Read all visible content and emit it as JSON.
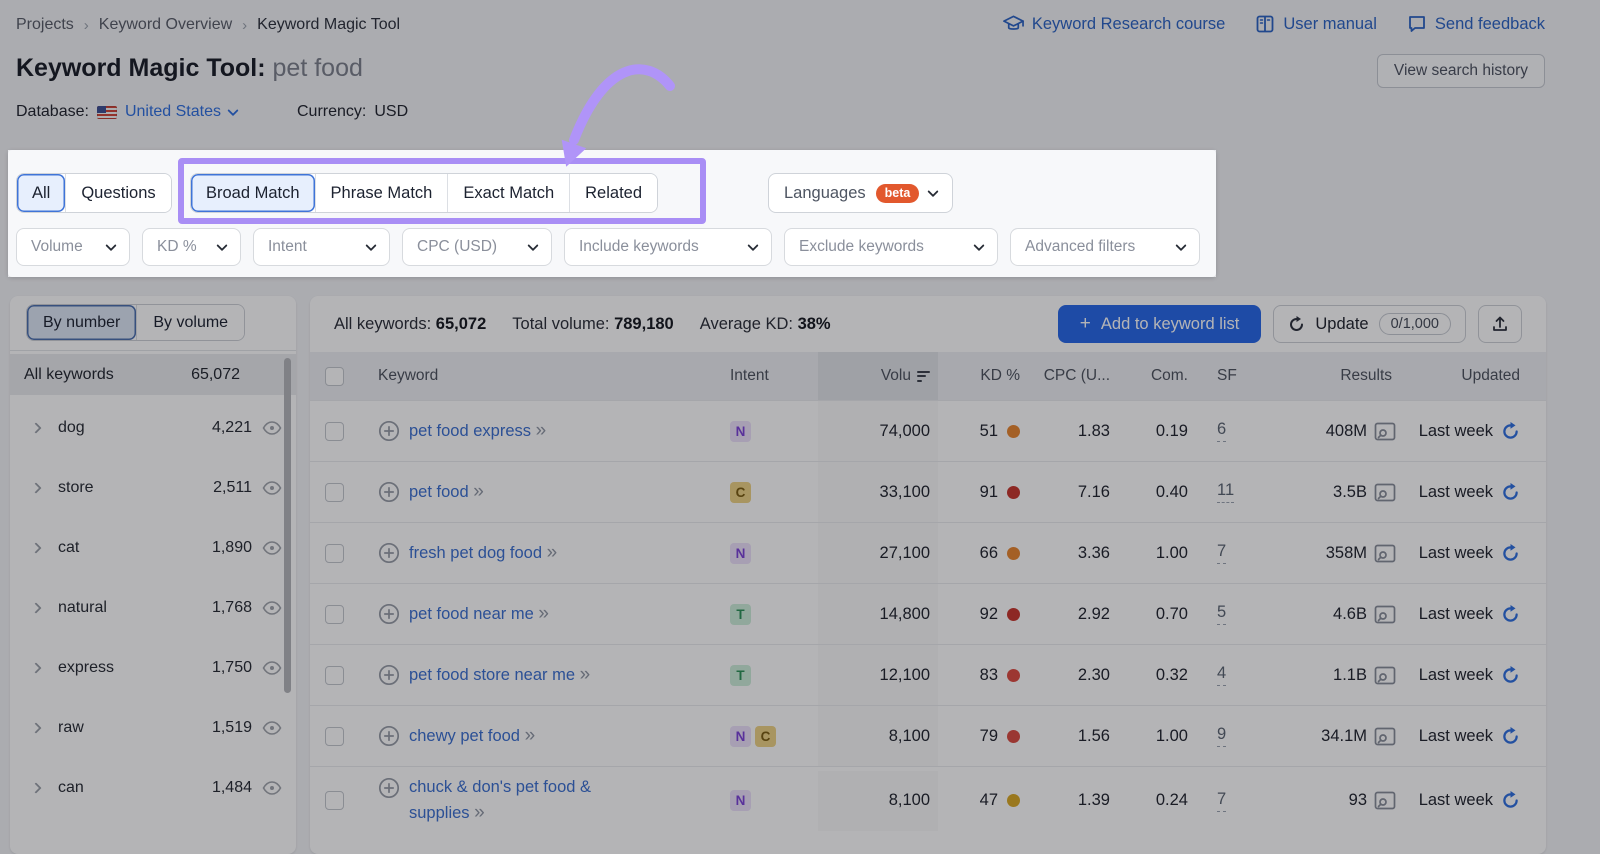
{
  "breadcrumb": {
    "items": [
      "Projects",
      "Keyword Overview",
      "Keyword Magic Tool"
    ]
  },
  "header": {
    "title": "Keyword Magic Tool:",
    "query": "pet food",
    "links": [
      {
        "label": "Keyword Research course",
        "icon": "graduation-cap-icon"
      },
      {
        "label": "User manual",
        "icon": "book-icon"
      },
      {
        "label": "Send feedback",
        "icon": "chat-icon"
      }
    ],
    "view_history": "View search history",
    "database_label": "Database:",
    "database_value": "United States",
    "currency_label": "Currency:",
    "currency_value": "USD"
  },
  "filters": {
    "scope_tabs": [
      {
        "label": "All",
        "selected": true
      },
      {
        "label": "Questions",
        "selected": false
      }
    ],
    "match_tabs": [
      {
        "label": "Broad Match",
        "selected": true
      },
      {
        "label": "Phrase Match",
        "selected": false
      },
      {
        "label": "Exact Match",
        "selected": false
      },
      {
        "label": "Related",
        "selected": false
      }
    ],
    "languages_label": "Languages",
    "beta_label": "beta",
    "dropdowns": [
      "Volume",
      "KD %",
      "Intent",
      "CPC (USD)",
      "Include keywords",
      "Exclude keywords",
      "Advanced filters"
    ]
  },
  "sidebar": {
    "toggle": [
      {
        "label": "By number",
        "selected": true
      },
      {
        "label": "By volume",
        "selected": false
      }
    ],
    "all_row": {
      "label": "All keywords",
      "count": "65,072"
    },
    "groups": [
      {
        "name": "dog",
        "count": "4,221"
      },
      {
        "name": "store",
        "count": "2,511"
      },
      {
        "name": "cat",
        "count": "1,890"
      },
      {
        "name": "natural",
        "count": "1,768"
      },
      {
        "name": "express",
        "count": "1,750"
      },
      {
        "name": "raw",
        "count": "1,519"
      },
      {
        "name": "can",
        "count": "1,484"
      }
    ]
  },
  "toolbar": {
    "stats": [
      {
        "label": "All keywords:",
        "value": "65,072"
      },
      {
        "label": "Total volume:",
        "value": "789,180"
      },
      {
        "label": "Average KD:",
        "value": "38%"
      }
    ],
    "add_label": "Add to keyword list",
    "update_label": "Update",
    "update_count": "0/1,000"
  },
  "table": {
    "headers": {
      "keyword": "Keyword",
      "intent": "Intent",
      "volume": "Volu",
      "kd": "KD %",
      "cpc": "CPC (U...",
      "com": "Com.",
      "sf": "SF",
      "results": "Results",
      "updated": "Updated"
    },
    "intent_styles": {
      "N": {
        "bg": "#ece1fb",
        "fg": "#7c42d8"
      },
      "C": {
        "bg": "#eed384",
        "fg": "#7a5c10"
      },
      "T": {
        "bg": "#cdeeda",
        "fg": "#2c9158"
      }
    },
    "rows": [
      {
        "keyword": "pet food express",
        "intents": [
          "N"
        ],
        "volume": "74,000",
        "kd": "51",
        "kd_color": "#e8862f",
        "cpc": "1.83",
        "com": "0.19",
        "sf": "6",
        "results": "408M",
        "updated": "Last week"
      },
      {
        "keyword": "pet food",
        "intents": [
          "C"
        ],
        "volume": "33,100",
        "kd": "91",
        "kd_color": "#c7352c",
        "cpc": "7.16",
        "com": "0.40",
        "sf": "11",
        "results": "3.5B",
        "updated": "Last week"
      },
      {
        "keyword": "fresh pet dog food",
        "intents": [
          "N"
        ],
        "volume": "27,100",
        "kd": "66",
        "kd_color": "#e8862f",
        "cpc": "3.36",
        "com": "1.00",
        "sf": "7",
        "results": "358M",
        "updated": "Last week"
      },
      {
        "keyword": "pet food near me",
        "intents": [
          "T"
        ],
        "volume": "14,800",
        "kd": "92",
        "kd_color": "#c7352c",
        "cpc": "2.92",
        "com": "0.70",
        "sf": "5",
        "results": "4.6B",
        "updated": "Last week"
      },
      {
        "keyword": "pet food store near me",
        "intents": [
          "T"
        ],
        "volume": "12,100",
        "kd": "83",
        "kd_color": "#dd4b41",
        "cpc": "2.30",
        "com": "0.32",
        "sf": "4",
        "results": "1.1B",
        "updated": "Last week"
      },
      {
        "keyword": "chewy pet food",
        "intents": [
          "N",
          "C"
        ],
        "volume": "8,100",
        "kd": "79",
        "kd_color": "#d94b40",
        "cpc": "1.56",
        "com": "1.00",
        "sf": "9",
        "results": "34.1M",
        "updated": "Last week"
      },
      {
        "keyword": "chuck & don's pet food & supplies",
        "intents": [
          "N"
        ],
        "volume": "8,100",
        "kd": "47",
        "kd_color": "#d9a823",
        "cpc": "1.39",
        "com": "0.24",
        "sf": "7",
        "results": "93",
        "updated": "Last week"
      }
    ]
  },
  "annotation_color": "#a98ef5"
}
